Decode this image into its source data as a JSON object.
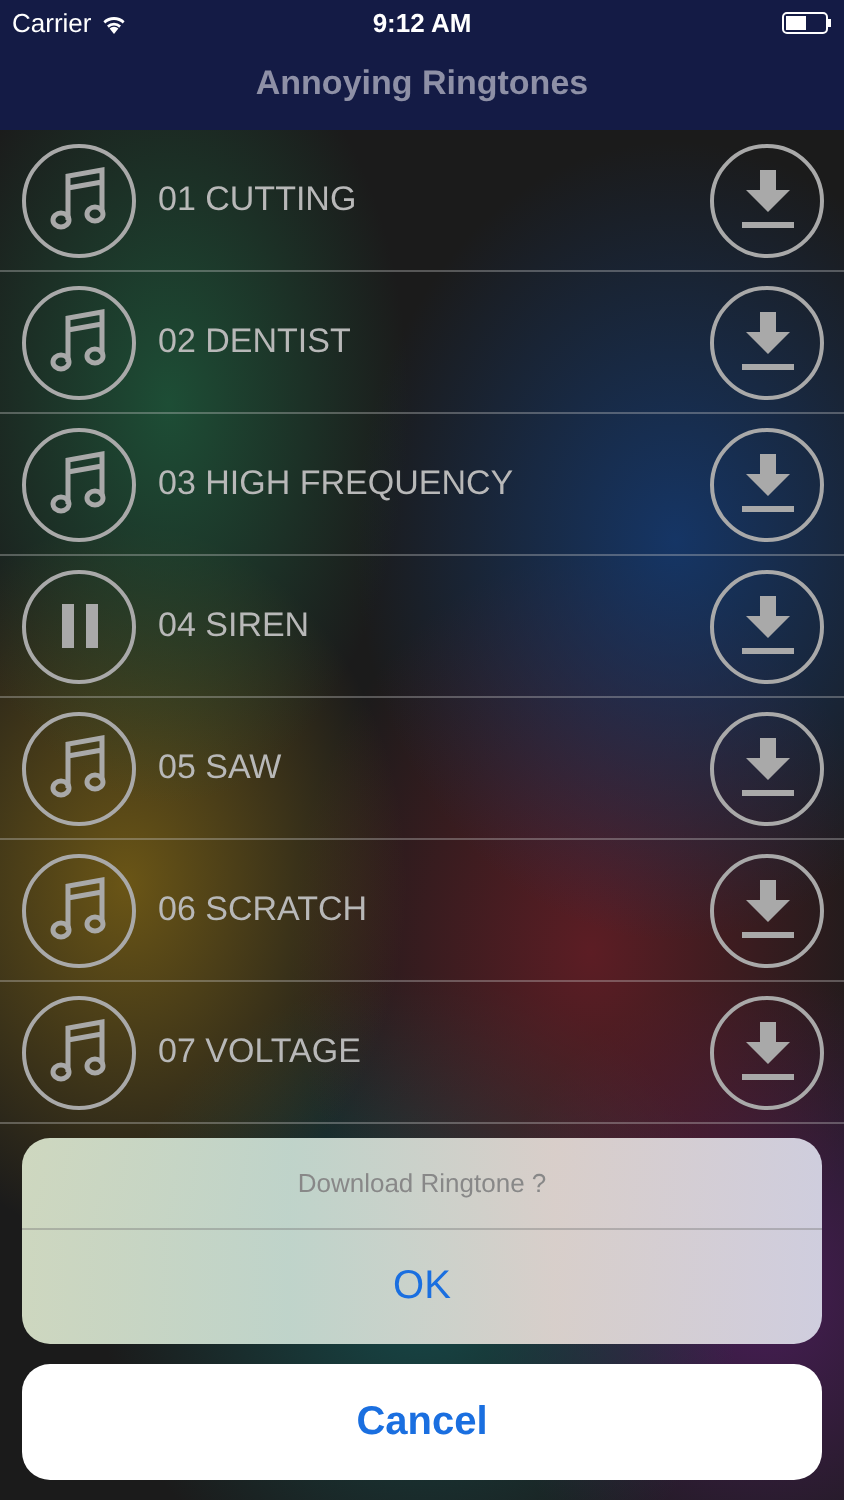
{
  "status_bar": {
    "carrier": "Carrier",
    "time": "9:12 AM"
  },
  "nav": {
    "title": "Annoying Ringtones"
  },
  "ringtones": [
    {
      "title": "01 CUTTING",
      "playing": false
    },
    {
      "title": "02 DENTIST",
      "playing": false
    },
    {
      "title": "03 HIGH FREQUENCY",
      "playing": false
    },
    {
      "title": "04 SIREN",
      "playing": true
    },
    {
      "title": "05 SAW",
      "playing": false
    },
    {
      "title": "06 SCRATCH",
      "playing": false
    },
    {
      "title": "07 VOLTAGE",
      "playing": false
    }
  ],
  "action_sheet": {
    "title": "Download Ringtone ?",
    "ok": "OK",
    "cancel": "Cancel"
  }
}
